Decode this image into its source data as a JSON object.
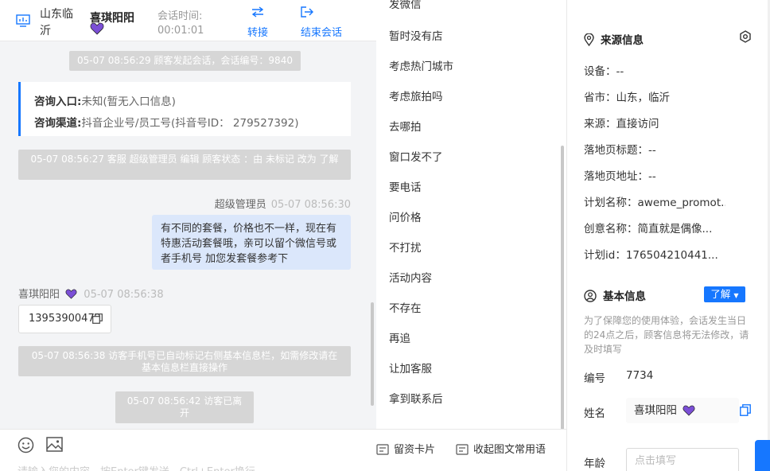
{
  "header": {
    "location": "山东临沂",
    "customer_name": "喜琪阳阳",
    "session_time_label": "会话时间:",
    "session_time": "00:01:01",
    "transfer_label": "转接",
    "end_label": "结束会话"
  },
  "messages": {
    "sys1": "05-07 08:56:29 顾客发起会话，会话编号：9840",
    "card": {
      "entry_label": "咨询入口:",
      "entry_value": "未知(暂无入口信息)",
      "channel_label": "咨询渠道:",
      "channel_value": "抖音企业号/员工号(抖音号ID： 279527392)"
    },
    "sys2": "05-07 08:56:27 客服 超级管理员 编辑 顾客状态 ：由 未标记 改为 了解",
    "agent_name": "超级管理员",
    "agent_time": "05-07 08:56:30",
    "agent_text": "有不同的套餐，价格也不一样，现在有特惠活动套餐哦，亲可以留个微信号或者手机号 加您发套餐参考下",
    "visitor_name": "喜琪阳阳",
    "visitor_time": "05-07 08:56:38",
    "visitor_text": "13953900472",
    "sys3": "05-07 08:56:38 访客手机号已自动标记右侧基本信息栏，如需修改请在基本信息栏直接操作",
    "sys4": "05-07 08:56:42 访客已离开"
  },
  "compose": {
    "placeholder": "请输入您的内容，按Enter键发送，Ctrl+Enter换行"
  },
  "phrases": {
    "items": [
      "发微信",
      "暂时没有店",
      "考虑热门城市",
      "考虑旅拍吗",
      "去哪拍",
      "窗口发不了",
      "要电话",
      "问价格",
      "不打扰",
      "活动内容",
      "不存在",
      "再追",
      "让加客服",
      "拿到联系后"
    ],
    "footer_card": "留资卡片",
    "footer_collapse": "收起图文常用语"
  },
  "info": {
    "source_title": "来源信息",
    "device": "设备：--",
    "province": "省市：山东，临沂",
    "source": "来源：直接访问",
    "landing_title": "落地页标题：--",
    "landing_url": "落地页地址：--",
    "plan_name": "计划名称：aweme_promot...",
    "creative_name": "创意名称：简直就是偶像...",
    "plan_id": "计划id：176504210441...",
    "basic_title": "基本信息",
    "status_button": "了解",
    "note": "为了保障您的使用体验，会话发生当日的24点之后，顾客信息将无法修改，请及时填写",
    "id_label": "编号",
    "id_value": "7734",
    "name_label": "姓名",
    "name_value": "喜琪阳阳",
    "age_label": "年龄",
    "age_placeholder": "点击填写"
  },
  "colors": {
    "accent": "#1677ff",
    "heart": "#7b4fd6",
    "system_message_bg": "#d6d6d6",
    "agent_bubble_bg": "#dbe7fb"
  }
}
